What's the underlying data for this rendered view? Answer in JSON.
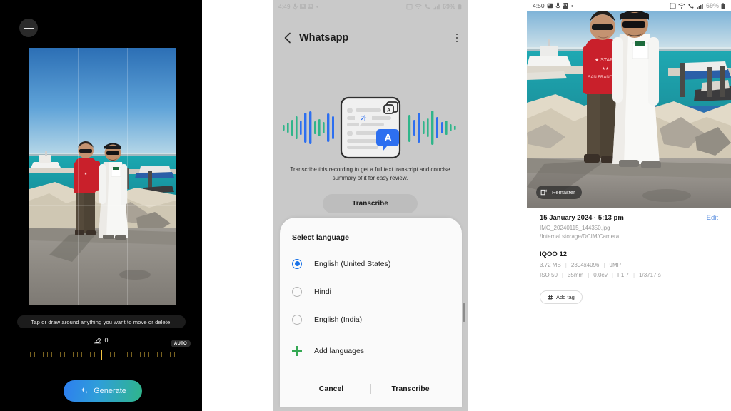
{
  "left_panel": {
    "app": "photo-ai-editor",
    "add_button_icon": "plus-icon",
    "hint": "Tap or draw around anything you want to move or delete.",
    "slider": {
      "icon": "eraser-icon",
      "value": "0",
      "auto_label": "AUTO"
    },
    "generate_button": {
      "label": "Generate",
      "icon": "sparkle-icon",
      "gradient_from": "#2d7ef0",
      "gradient_to": "#2fb58a"
    },
    "photo_alt": "Two men standing on a waterfront promenade by a marina"
  },
  "middle_panel": {
    "statusbar": {
      "time": "4:49",
      "left_icons": [
        "microphone-icon",
        "linkedin-icon",
        "linkedin-icon",
        "dot-icon"
      ],
      "right_icons": [
        "alarm-icon",
        "wifi-icon",
        "call-icon",
        "signal-icon"
      ],
      "battery": "69%"
    },
    "appbar": {
      "back_icon": "chevron-left-icon",
      "title": "Whatsapp",
      "menu_icon": "kebab-menu-icon"
    },
    "illustration": {
      "name": "transcribe-illustration",
      "phone_badge_icon": "translate-icon",
      "bubble_ko": "가",
      "bubble_en": "A",
      "wave_color_green": "#2fb58a",
      "wave_color_blue": "#2d6ff0"
    },
    "description": "Transcribe this recording to get a full text transcript and concise summary of it for easy review.",
    "transcribe_button": "Transcribe",
    "dialog": {
      "title": "Select language",
      "options": [
        {
          "label": "English (United States)",
          "selected": true
        },
        {
          "label": "Hindi",
          "selected": false
        },
        {
          "label": "English (India)",
          "selected": false
        }
      ],
      "add_languages": {
        "label": "Add languages",
        "icon": "plus-icon",
        "color": "#34a853"
      },
      "cancel_label": "Cancel",
      "confirm_label": "Transcribe",
      "accent": "#1a73e8"
    }
  },
  "right_panel": {
    "statusbar": {
      "time": "4:50",
      "left_icons": [
        "gallery-icon",
        "microphone-icon",
        "linkedin-icon",
        "dot-icon"
      ],
      "right_icons": [
        "alarm-icon",
        "wifi-icon",
        "call-icon",
        "signal-icon"
      ],
      "battery": "69%"
    },
    "remaster_button": {
      "label": "Remaster",
      "icon": "remaster-icon"
    },
    "details": {
      "datetime": "15 January 2024 · 5:13 pm",
      "edit_label": "Edit",
      "filename": "IMG_20240115_144350.jpg",
      "path": "/Internal storage/DCIM/Camera",
      "device": "IQOO 12",
      "file_meta": [
        "3.72 MB",
        "2304x4096",
        "9MP"
      ],
      "exif_meta": [
        "ISO 50",
        "35mm",
        "0.0ev",
        "F1.7",
        "1/3717 s"
      ],
      "add_tag_label": "Add tag",
      "add_tag_icon": "hash-icon",
      "edit_color": "#5a8fe0"
    },
    "photo_alt": "Two men standing on a waterfront promenade by a marina"
  }
}
